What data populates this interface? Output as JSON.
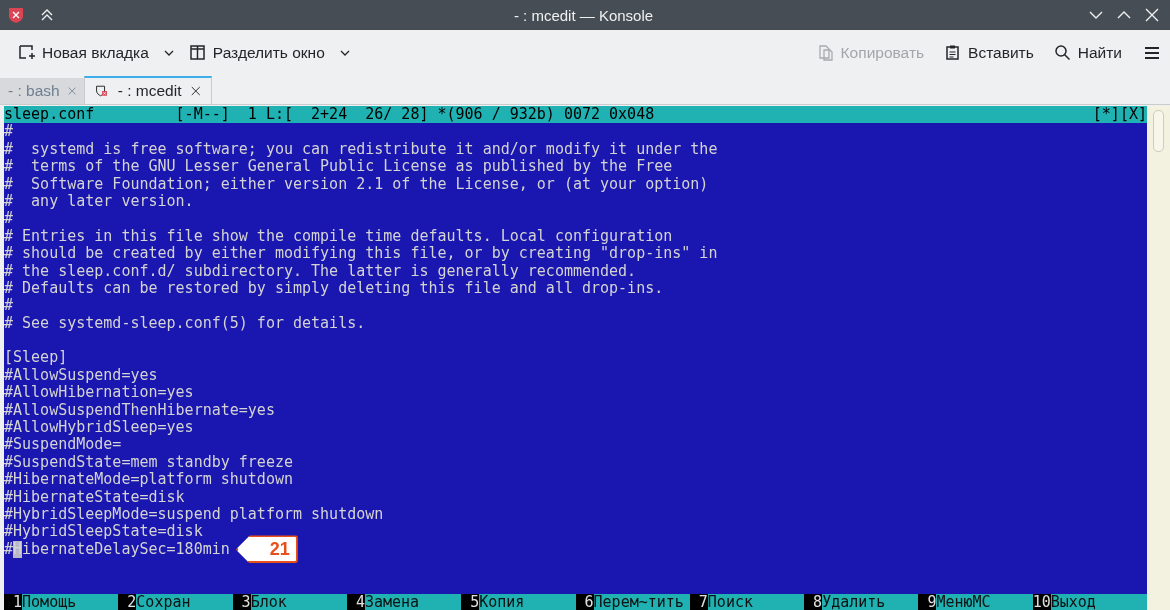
{
  "window": {
    "title": "- : mcedit — Konsole"
  },
  "toolbar": {
    "left": [
      {
        "label": "Новая вкладка",
        "kind": "new-tab",
        "dropdown": true,
        "disabled": false
      },
      {
        "label": "Разделить окно",
        "kind": "split",
        "dropdown": true,
        "disabled": false
      }
    ],
    "right": [
      {
        "label": "Копировать",
        "kind": "copy",
        "dropdown": false,
        "disabled": true
      },
      {
        "label": "Вставить",
        "kind": "paste",
        "dropdown": false,
        "disabled": false
      },
      {
        "label": "Найти",
        "kind": "search",
        "dropdown": false,
        "disabled": false
      }
    ]
  },
  "tabs": [
    {
      "label": "- : bash",
      "selected": false,
      "icon": false
    },
    {
      "label": "- : mcedit",
      "selected": true,
      "icon": true
    }
  ],
  "editor": {
    "status": {
      "filename": "sleep.conf",
      "info": "[-M--]  1 L:[  2+24  26/ 28] *(906 / 932b) 0072 0x048",
      "buttons": [
        "[*]",
        "[X]"
      ]
    },
    "lines": [
      {
        "text": "#",
        "cursor": false
      },
      {
        "text": "#  systemd is free software; you can redistribute it and/or modify it under the",
        "cursor": false
      },
      {
        "text": "#  terms of the GNU Lesser General Public License as published by the Free",
        "cursor": false
      },
      {
        "text": "#  Software Foundation; either version 2.1 of the License, or (at your option)",
        "cursor": false
      },
      {
        "text": "#  any later version.",
        "cursor": false
      },
      {
        "text": "#",
        "cursor": false
      },
      {
        "text": "# Entries in this file show the compile time defaults. Local configuration",
        "cursor": false
      },
      {
        "text": "# should be created by either modifying this file, or by creating \"drop-ins\" in",
        "cursor": false
      },
      {
        "text": "# the sleep.conf.d/ subdirectory. The latter is generally recommended.",
        "cursor": false
      },
      {
        "text": "# Defaults can be restored by simply deleting this file and all drop-ins.",
        "cursor": false
      },
      {
        "text": "#",
        "cursor": false
      },
      {
        "text": "# See systemd-sleep.conf(5) for details.",
        "cursor": false
      },
      {
        "cursor": false
      },
      {
        "text": "[Sleep]",
        "cursor": false
      },
      {
        "text": "#AllowSuspend=yes",
        "cursor": false
      },
      {
        "text": "#AllowHibernation=yes",
        "cursor": false
      },
      {
        "text": "#AllowSuspendThenHibernate=yes",
        "cursor": false
      },
      {
        "text": "#AllowHybridSleep=yes",
        "cursor": false
      },
      {
        "text": "#SuspendMode=",
        "cursor": false
      },
      {
        "text": "#SuspendState=mem standby freeze",
        "cursor": false
      },
      {
        "text": "#HibernateMode=platform shutdown",
        "cursor": false
      },
      {
        "text": "#HibernateState=disk",
        "cursor": false
      },
      {
        "text": "#HybridSleepMode=suspend platform shutdown",
        "cursor": false
      },
      {
        "text": "#HybridSleepState=disk",
        "cursor": false
      },
      {
        "text": "#HibernateDelaySec=180min",
        "cursor": true,
        "callout": "21"
      }
    ],
    "keys": [
      {
        "key": "1",
        "label": "Помощь"
      },
      {
        "key": "2",
        "label": "Сохран"
      },
      {
        "key": "3",
        "label": "Блок"
      },
      {
        "key": "4",
        "label": "Замена"
      },
      {
        "key": "5",
        "label": "Копия"
      },
      {
        "key": "6",
        "label": "Перем~тить"
      },
      {
        "key": "7",
        "label": "Поиск"
      },
      {
        "key": "8",
        "label": "Удалить"
      },
      {
        "key": "9",
        "label": "МенюМС"
      },
      {
        "key": "10",
        "label": "Выход"
      }
    ]
  }
}
